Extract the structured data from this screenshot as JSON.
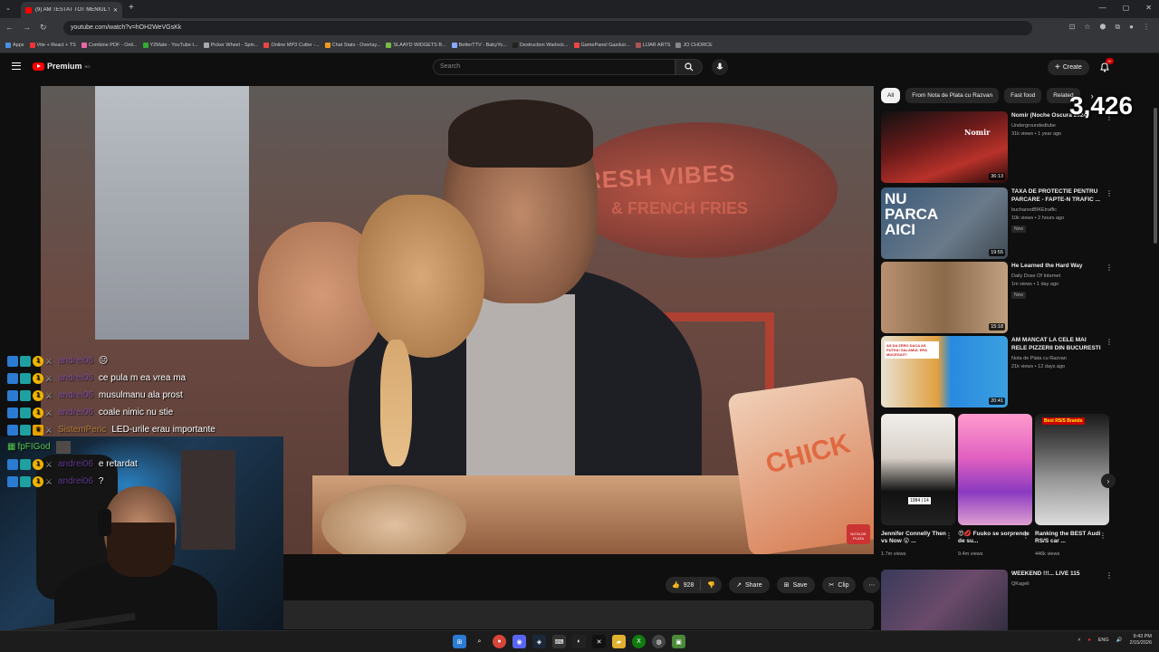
{
  "browser": {
    "tab_title": "(9) AM TESTAT TOT MENIUL SF...",
    "url": "youtube.com/watch?v=hOH2WeVGsKk",
    "bookmarks": [
      "Apps",
      "Vite + React + TS",
      "Combine PDF - Onli...",
      "Y2Mate - YouTube t...",
      "Picker Wheel - Spin...",
      "Online MP3 Cutter -...",
      "Chat Stats - Overlay...",
      "SLAAYD WIDGETS B...",
      "BetterTTV - BabyYo...",
      "Destruction Warlock...",
      "GamePanel Gazduir...",
      "LIJAR ARTS",
      "JO CHORCE"
    ]
  },
  "youtube": {
    "logo_text": "Premium",
    "logo_region": "RO",
    "search_placeholder": "Search",
    "create_label": "Create",
    "notif_count": "9+"
  },
  "viewer_count": "3,426",
  "player": {
    "banner_line1": "RESH VIBES",
    "banner_line2": "& FRENCH FRIES",
    "fries_text": "CHICK",
    "channel_logo": "NOTA DE PLATA"
  },
  "actions": {
    "likes": "928",
    "share": "Share",
    "save": "Save",
    "clip": "Clip"
  },
  "chips": [
    "All",
    "From Nota de Plata cu Razvan",
    "Fast food",
    "Related"
  ],
  "recommendations": [
    {
      "title": "Nomir (Noche Oscura 2024)",
      "channel": "Undergroundedtube",
      "meta": "31k views • 1 year ago",
      "duration": "36:13",
      "new": "",
      "thumb_text": "Nomir"
    },
    {
      "title": "TAXA DE PROTECTIE PENTRU PARCARE - FAPTE-N TRAFIC ...",
      "channel": "bucharestBIKEtraffic",
      "meta": "10k views • 2 hours ago",
      "duration": "19:55",
      "new": "New",
      "thumb_text": "NU PARCA AICI"
    },
    {
      "title": "He Learned the Hard Way",
      "channel": "Daily Dose Of Internet",
      "meta": "1m views • 1 day ago",
      "duration": "15:18",
      "new": "New",
      "thumb_text": ""
    },
    {
      "title": "AM MANCAT LA CELE MAI RELE PIZZERII DIN BUCURESTI",
      "channel": "Nota de Plata cu Razvan",
      "meta": "21k views • 12 days ago",
      "duration": "20:41",
      "new": "",
      "thumb_text": "AS DA ZERO DACA AS PUTEA! SALAMUL ERA MUCEGAIT!"
    }
  ],
  "shorts": [
    {
      "title": "Jennifer Connelly Then vs Now 😮 ...",
      "views": "1.7m views",
      "badge": "1984 | 14"
    },
    {
      "title": "😍💋 Fuuko se sorprende de su...",
      "views": "9.4m views",
      "badge": ""
    },
    {
      "title": "Ranking the BEST Audi RS/S car ...",
      "views": "446k views",
      "badge": "Best RS/S Brands"
    }
  ],
  "last_rec": {
    "title": "WEEKEND !!!... LIVE 115",
    "channel": "QKageli"
  },
  "chat": [
    {
      "name": "andrei06",
      "msg": "😐",
      "badges": [
        "b1",
        "b2",
        "b3",
        "b4"
      ]
    },
    {
      "name": "andrei06",
      "msg": "ce pula m ea vrea ma",
      "badges": [
        "b1",
        "b2",
        "b3",
        "b4"
      ]
    },
    {
      "name": "andrei06",
      "msg": "musulmanu ala prost",
      "badges": [
        "b1",
        "b2",
        "b3",
        "b4"
      ]
    },
    {
      "name": "andrei06",
      "msg": "coale nimic nu stie",
      "badges": [
        "b1",
        "b2",
        "b3",
        "b4"
      ]
    },
    {
      "name": "SistemPeric",
      "msg": "LED-urile erau importante",
      "badges": [
        "b1",
        "b2",
        "b3",
        "b4"
      ]
    },
    {
      "name": "fpFIGod",
      "msg": "",
      "badges": [
        "bot"
      ]
    },
    {
      "name": "andrei06",
      "msg": "e retardat",
      "badges": [
        "b1",
        "b2",
        "b3",
        "b4"
      ]
    },
    {
      "name": "andrei06",
      "msg": "?",
      "badges": [
        "b1",
        "b2",
        "b3",
        "b4"
      ]
    }
  ],
  "taskbar": {
    "time": "9:43 PM",
    "date": "2/15/2026",
    "lang": "ENG"
  }
}
